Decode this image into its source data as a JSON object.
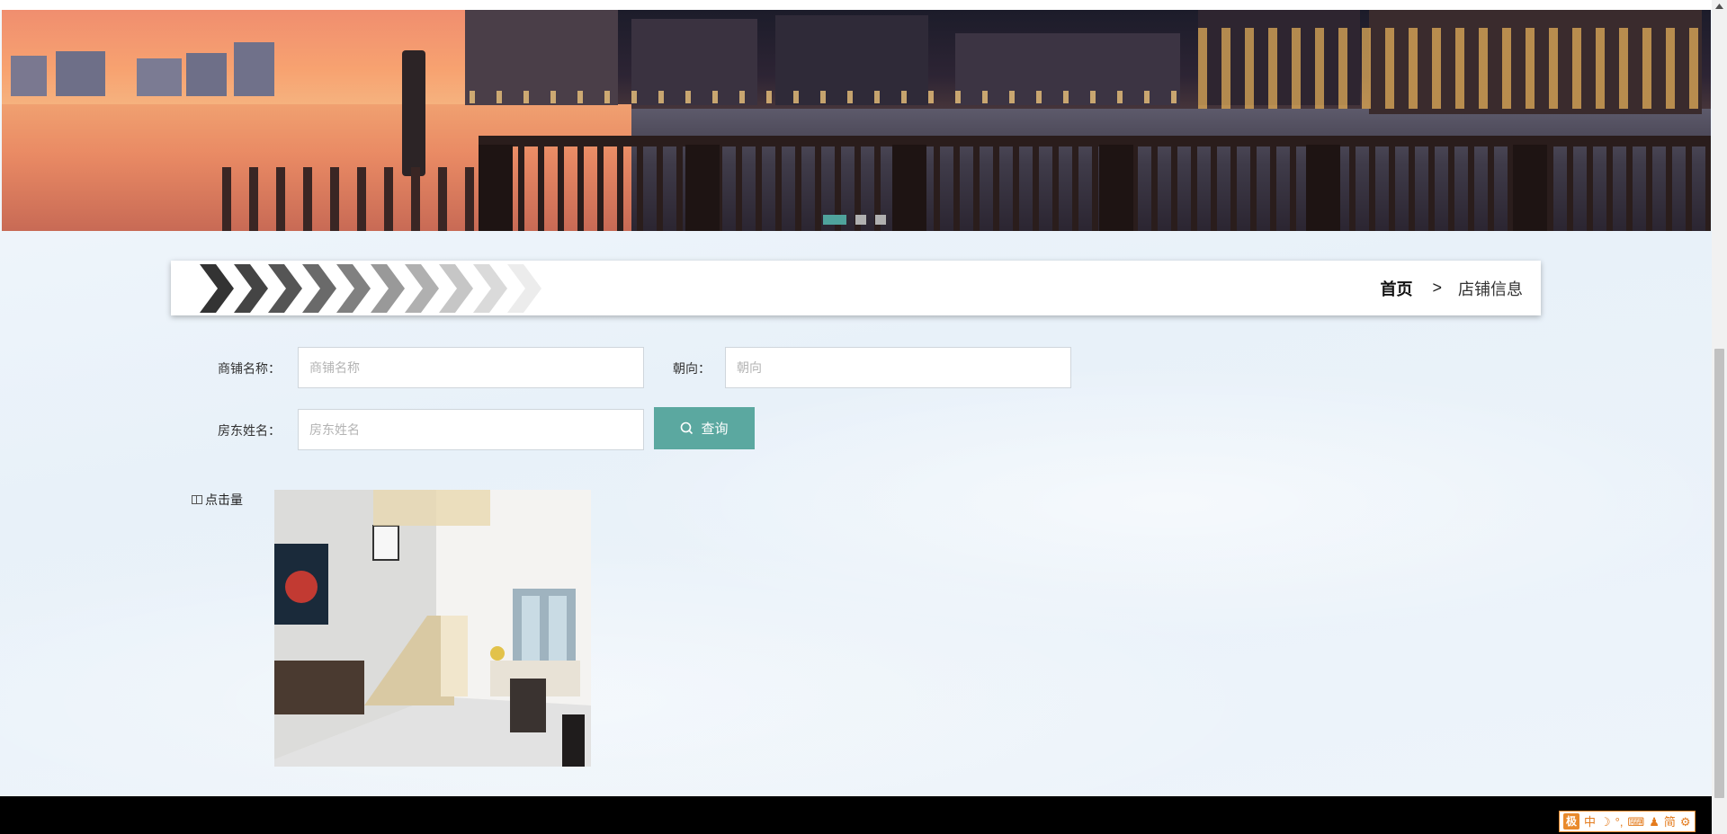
{
  "breadcrumb": {
    "home": "首页",
    "separator": ">",
    "current": "店铺信息"
  },
  "search": {
    "shop_name_label": "商铺名称：",
    "shop_name_placeholder": "商铺名称",
    "orientation_label": "朝向：",
    "orientation_placeholder": "朝向",
    "landlord_label": "房东姓名：",
    "landlord_placeholder": "房东姓名",
    "button_label": "查询"
  },
  "sort": {
    "label": "点击量"
  },
  "carousel": {
    "slides": 3,
    "active_index": 0
  },
  "ime": {
    "logo": "极",
    "mode": "中",
    "simplified": "简"
  },
  "colors": {
    "accent": "#5ba8a0",
    "footer": "#000000",
    "page_bg": "#eef4fa"
  }
}
